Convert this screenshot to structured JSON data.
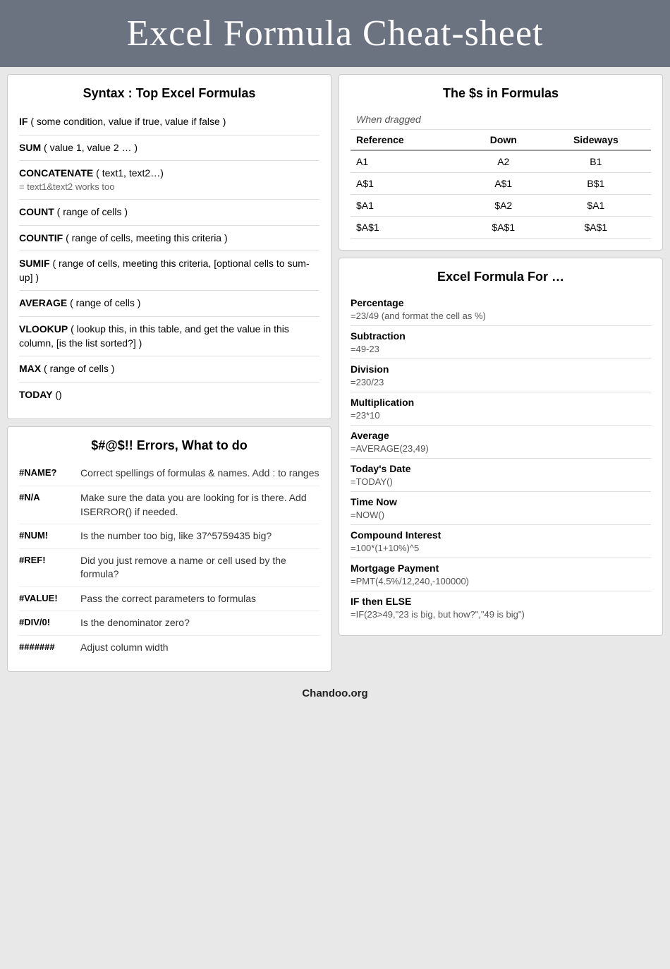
{
  "header": {
    "title": "Excel Formula Cheat-sheet"
  },
  "syntax": {
    "title": "Syntax : Top Excel Formulas",
    "items": [
      {
        "name": "IF",
        "desc": "( some condition, value if true, value if false )",
        "sub": ""
      },
      {
        "name": "SUM",
        "desc": "( value 1, value 2 … )",
        "sub": ""
      },
      {
        "name": "CONCATENATE",
        "desc": "( text1, text2…)",
        "sub": "= text1&text2 works too"
      },
      {
        "name": "COUNT",
        "desc": "( range of cells )",
        "sub": ""
      },
      {
        "name": "COUNTIF",
        "desc": "( range of cells, meeting this criteria )",
        "sub": ""
      },
      {
        "name": "SUMIF",
        "desc": "( range of cells, meeting this criteria, [optional cells to sum-up] )",
        "sub": ""
      },
      {
        "name": "AVERAGE",
        "desc": "( range of cells )",
        "sub": ""
      },
      {
        "name": "VLOOKUP",
        "desc": "( lookup this, in this table, and get the value in this column, [is the list sorted?] )",
        "sub": ""
      },
      {
        "name": "MAX",
        "desc": "( range of cells )",
        "sub": ""
      },
      {
        "name": "TODAY",
        "desc": "()",
        "sub": ""
      }
    ]
  },
  "dollars": {
    "title": "The $s in Formulas",
    "when_dragged": "When dragged",
    "headers": [
      "Reference",
      "Down",
      "Sideways"
    ],
    "rows": [
      [
        "A1",
        "A2",
        "B1"
      ],
      [
        "A$1",
        "A$1",
        "B$1"
      ],
      [
        "$A1",
        "$A2",
        "$A1"
      ],
      [
        "$A$1",
        "$A$1",
        "$A$1"
      ]
    ]
  },
  "errors": {
    "title": "$#@$!! Errors, What to do",
    "items": [
      {
        "code": "#NAME?",
        "desc": "Correct spellings of formulas & names. Add : to ranges"
      },
      {
        "code": "#N/A",
        "desc": "Make sure the data you are looking for is there. Add ISERROR() if needed."
      },
      {
        "code": "#NUM!",
        "desc": "Is the number too big, like 37^5759435 big?"
      },
      {
        "code": "#REF!",
        "desc": "Did you just remove a name or cell used by the formula?"
      },
      {
        "code": "#VALUE!",
        "desc": "Pass the correct parameters to formulas"
      },
      {
        "code": "#DIV/0!",
        "desc": "Is the denominator zero?"
      },
      {
        "code": "#######",
        "desc": "Adjust column width"
      }
    ]
  },
  "formula_for": {
    "title": "Excel Formula For …",
    "items": [
      {
        "label": "Percentage",
        "value": "=23/49 (and format the cell as %)"
      },
      {
        "label": "Subtraction",
        "value": "=49-23"
      },
      {
        "label": "Division",
        "value": "=230/23"
      },
      {
        "label": "Multiplication",
        "value": "=23*10"
      },
      {
        "label": "Average",
        "value": "=AVERAGE(23,49)"
      },
      {
        "label": "Today's Date",
        "value": "=TODAY()"
      },
      {
        "label": "Time Now",
        "value": "=NOW()"
      },
      {
        "label": "Compound Interest",
        "value": "=100*(1+10%)^5"
      },
      {
        "label": "Mortgage Payment",
        "value": "=PMT(4.5%/12,240,-100000)"
      },
      {
        "label": "IF then ELSE",
        "value": "=IF(23>49,\"23 is big, but how?\",\"49 is big\")"
      }
    ]
  },
  "footer": {
    "text": "Chandoo.org"
  }
}
